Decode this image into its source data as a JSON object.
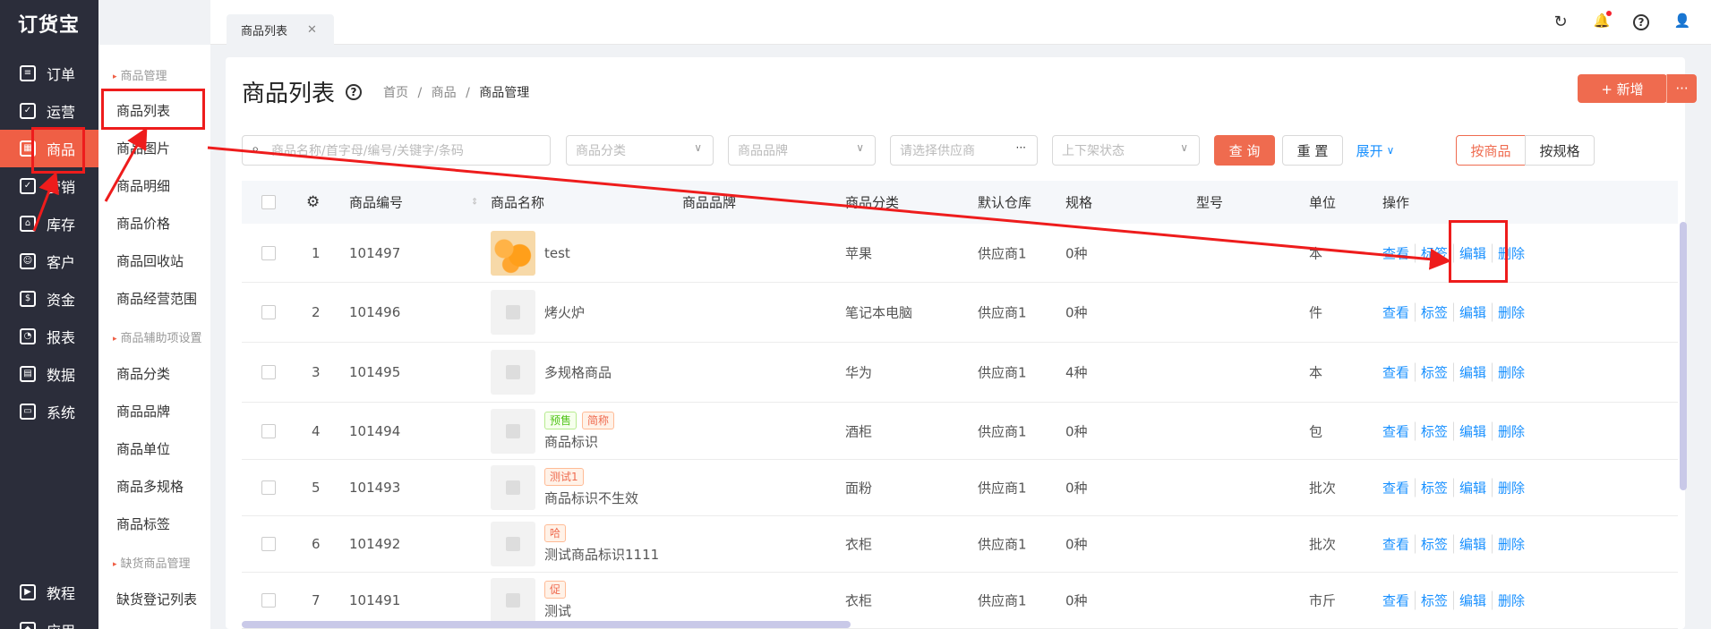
{
  "app": {
    "logo": "订货宝"
  },
  "nav": [
    {
      "label": "订单",
      "icon": "order-icon",
      "glyph": "≡"
    },
    {
      "label": "运营",
      "icon": "operation-icon",
      "glyph": "✓"
    },
    {
      "label": "商品",
      "icon": "goods-icon",
      "glyph": "▦"
    },
    {
      "label": "营销",
      "icon": "marketing-icon",
      "glyph": "✓"
    },
    {
      "label": "库存",
      "icon": "warehouse-icon",
      "glyph": "⌂"
    },
    {
      "label": "客户",
      "icon": "customer-icon",
      "glyph": "☺"
    },
    {
      "label": "资金",
      "icon": "money-icon",
      "glyph": "$"
    },
    {
      "label": "报表",
      "icon": "report-icon",
      "glyph": "◔"
    },
    {
      "label": "数据",
      "icon": "data-icon",
      "glyph": "▤"
    },
    {
      "label": "系统",
      "icon": "system-icon",
      "glyph": "▭"
    },
    {
      "label": "教程",
      "icon": "tutorial-icon",
      "glyph": "▶"
    },
    {
      "label": "应用",
      "icon": "app-icon",
      "glyph": "◆"
    }
  ],
  "submenu": {
    "groups": [
      "商品管理",
      "商品辅助项设置",
      "缺货商品管理"
    ],
    "items": [
      "商品列表",
      "商品图片",
      "商品明细",
      "商品价格",
      "商品回收站",
      "商品经营范围",
      "商品分类",
      "商品品牌",
      "商品单位",
      "商品多规格",
      "商品标签",
      "缺货登记列表"
    ]
  },
  "tabs": [
    {
      "label": "商品列表",
      "close": "✕"
    }
  ],
  "topicons": {
    "refresh": "↻",
    "bell": "🔔",
    "help": "?",
    "user": "👤"
  },
  "page": {
    "title": "商品列表",
    "help": "?",
    "breadcrumb": [
      "首页",
      "商品",
      "商品管理"
    ],
    "sep": "/",
    "new_label": "+ 新增",
    "more": "···"
  },
  "filters": {
    "search_placeholder": "商品名称/首字母/编号/关键字/条码",
    "category": "商品分类",
    "brand": "商品品牌",
    "supplier": "请选择供应商",
    "status": "上下架状态",
    "query": "查 询",
    "reset": "重 置",
    "expand": "展开",
    "by_goods": "按商品",
    "by_spec": "按规格"
  },
  "table": {
    "headers": {
      "code": "商品编号",
      "name": "商品名称",
      "brand": "商品品牌",
      "category": "商品分类",
      "warehouse": "默认仓库",
      "spec": "规格",
      "model": "型号",
      "unit": "单位",
      "ops": "操作"
    },
    "ops": [
      "查看",
      "标签",
      "编辑",
      "删除"
    ],
    "rows": [
      {
        "no": "1",
        "code": "101497",
        "name": "test",
        "tags": [],
        "category": "苹果",
        "warehouse": "供应商1",
        "spec": "0种",
        "unit": "本"
      },
      {
        "no": "2",
        "code": "101496",
        "name": "烤火炉",
        "tags": [],
        "category": "笔记本电脑",
        "warehouse": "供应商1",
        "spec": "0种",
        "unit": "件"
      },
      {
        "no": "3",
        "code": "101495",
        "name": "多规格商品",
        "tags": [],
        "category": "华为",
        "warehouse": "供应商1",
        "spec": "4种",
        "unit": "本"
      },
      {
        "no": "4",
        "code": "101494",
        "name": "商品标识",
        "tags": [
          {
            "t": "预售",
            "c": "g"
          },
          {
            "t": "简称",
            "c": "r"
          }
        ],
        "category": "酒柜",
        "warehouse": "供应商1",
        "spec": "0种",
        "unit": "包"
      },
      {
        "no": "5",
        "code": "101493",
        "name": "商品标识不生效",
        "tags": [
          {
            "t": "测试1",
            "c": "r"
          }
        ],
        "category": "面粉",
        "warehouse": "供应商1",
        "spec": "0种",
        "unit": "批次"
      },
      {
        "no": "6",
        "code": "101492",
        "name": "测试商品标识1111",
        "tags": [
          {
            "t": "哈",
            "c": "r"
          }
        ],
        "category": "衣柜",
        "warehouse": "供应商1",
        "spec": "0种",
        "unit": "批次"
      },
      {
        "no": "7",
        "code": "101491",
        "name": "测试",
        "tags": [
          {
            "t": "促",
            "c": "r"
          }
        ],
        "category": "衣柜",
        "warehouse": "供应商1",
        "spec": "0种",
        "unit": "市斤"
      }
    ]
  }
}
